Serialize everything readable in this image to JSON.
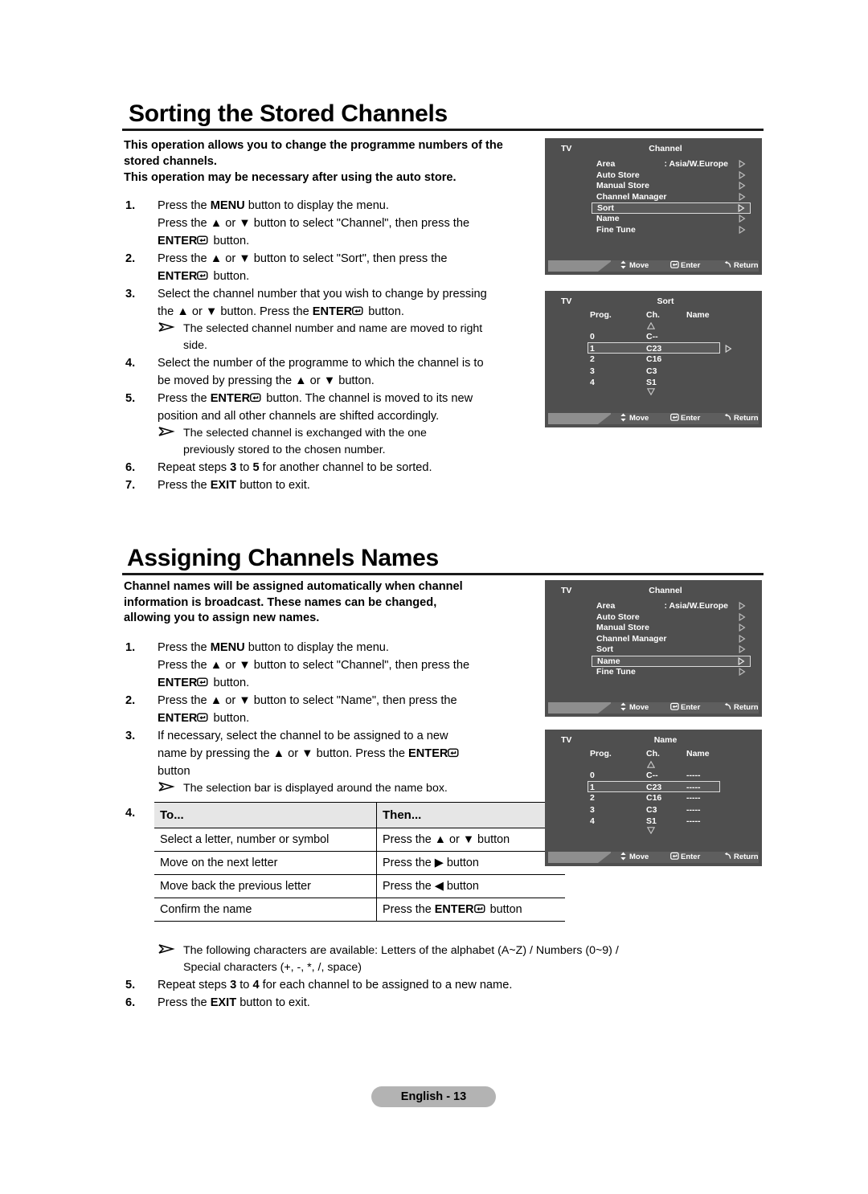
{
  "document": {
    "footer_label": "English - 13"
  },
  "section1": {
    "heading": "Sorting the Stored Channels",
    "intro_line1": "This operation allows you to change the programme numbers of the stored channels.",
    "intro_line2": "This operation may be necessary after using the auto store.",
    "steps": [
      {
        "num": "1.",
        "text_parts": [
          "Press the ",
          "MENU",
          " button to display the menu."
        ]
      },
      {
        "num": "2.",
        "text": "Press the ▲ or ▼ button to select \"Sort\", then press the ENTER button."
      },
      {
        "num": "3.",
        "text": "Select the channel number that you wish to change by pressing the ▲ or ▼ button. Press the ENTER button."
      },
      {
        "num": "4.",
        "text": "Select the number of the programme to which the channel is to be moved by pressing the ▲ or ▼ button."
      },
      {
        "num": "5.",
        "text": "Press the ENTER button. The channel is moved to its new position and all other channels are shifted accordingly."
      },
      {
        "num": "6.",
        "text": "Repeat steps 3 to 5 for another channel to be sorted."
      },
      {
        "num": "7.",
        "text": "Press the EXIT button to exit."
      }
    ],
    "step1_line1_a": "Press the ",
    "step1_line1_menu": "MENU",
    "step1_line1_b": " button to display the menu.",
    "step1_line2_a": "Press the ▲ or ▼ button to select \"Channel\", then press the",
    "step1_line3_enter": "ENTER",
    "step1_line3_b": " button.",
    "step2_a": "Press the ▲ or ▼ button to select \"Sort\", then press the",
    "step2_enter": "ENTER",
    "step2_b": " button.",
    "step3_a": "Select the channel number that you wish to change by pressing",
    "step3_b": "the ▲ or ▼ button. Press the ",
    "step3_enter": "ENTER",
    "step3_c": " button.",
    "note3_line1": "The selected channel number and name are moved to right",
    "note3_line2": "side.",
    "step4_a": "Select the number of the programme to which the channel is to",
    "step4_b": "be moved by pressing the ▲ or ▼ button.",
    "step5_a": "Press the ",
    "step5_enter": "ENTER",
    "step5_b": " button. The channel is moved to its new",
    "step5_c": "position and all other channels are shifted accordingly.",
    "note5_line1": "The selected channel is exchanged with the one",
    "note5_line2": "previously stored to the chosen number.",
    "step6_a": "Repeat steps ",
    "step6_n1": "3",
    "step6_b": " to ",
    "step6_n2": "5",
    "step6_c": " for another channel to be sorted.",
    "step7_a": "Press the ",
    "step7_exit": "EXIT",
    "step7_b": " button to exit."
  },
  "section2": {
    "heading": "Assigning Channels Names",
    "intro_line1": "Channel names will be assigned automatically when channel",
    "intro_line2": "information is broadcast. These names can be changed,",
    "intro_line3": "allowing you to assign new names.",
    "step1_line1_a": "Press the ",
    "step1_line1_menu": "MENU",
    "step1_line1_b": " button to display the menu.",
    "step1_line2": "Press the ▲ or ▼ button to select \"Channel\", then press the",
    "step1_line3_enter": "ENTER",
    "step1_line3_b": " button.",
    "step2_a": "Press the ▲ or ▼ button to select \"Name\", then press the",
    "step2_enter": "ENTER",
    "step2_b": " button.",
    "step3_a": "If necessary, select the channel to be assigned to a new",
    "step3_b": "name by pressing the ▲ or ▼ button. Press the ",
    "step3_enter": "ENTER",
    "step3_c": "button",
    "note3": "The selection bar is displayed around the name box.",
    "step4_num": "4.",
    "table": {
      "headers": [
        "To...",
        "Then..."
      ],
      "rows": [
        {
          "to": "Select a letter, number or symbol",
          "then_a": "Press the ▲ or ▼ button",
          "bold": false
        },
        {
          "to": "Move on the next letter",
          "then_a": "Press the ▶ button",
          "bold": false
        },
        {
          "to": "Move back the previous letter",
          "then_a": "Press the ◀ button",
          "bold": false
        },
        {
          "to": "Confirm the name",
          "then_a": "Press the ",
          "then_enter": "ENTER",
          "then_b": " button",
          "bold": true
        }
      ]
    },
    "note4_line1": "The following characters are available: Letters of the alphabet (A~Z) / Numbers (0~9) /",
    "note4_line2": "Special characters (+, -, *, /, space)",
    "step5_a": "Repeat steps ",
    "step5_n1": "3",
    "step5_b": " to ",
    "step5_n2": "4",
    "step5_c": " for each channel to be assigned to a new name.",
    "step6_a": "Press the ",
    "step6_exit": "EXIT",
    "step6_b": " button to exit."
  },
  "osd_channel_sort": {
    "tv_label": "TV",
    "title": "Channel",
    "items": [
      {
        "label": "Area",
        "value": ": Asia/W.Europe",
        "selected": false
      },
      {
        "label": "Auto Store",
        "value": "",
        "selected": false
      },
      {
        "label": "Manual Store",
        "value": "",
        "selected": false
      },
      {
        "label": "Channel Manager",
        "value": "",
        "selected": false
      },
      {
        "label": "Sort",
        "value": "",
        "selected": true
      },
      {
        "label": "Name",
        "value": "",
        "selected": false
      },
      {
        "label": "Fine Tune",
        "value": "",
        "selected": false
      }
    ],
    "bar": {
      "move": "Move",
      "enter": "Enter",
      "return": "Return"
    }
  },
  "osd_sort": {
    "tv_label": "TV",
    "title": "Sort",
    "headers": {
      "prog": "Prog.",
      "ch": "Ch.",
      "name": "Name"
    },
    "rows": [
      {
        "prog": "0",
        "ch": "C--",
        "name": "",
        "selected": false
      },
      {
        "prog": "1",
        "ch": "C23",
        "name": "",
        "selected": true
      },
      {
        "prog": "2",
        "ch": "C16",
        "name": "",
        "selected": false
      },
      {
        "prog": "3",
        "ch": "C3",
        "name": "",
        "selected": false
      },
      {
        "prog": "4",
        "ch": "S1",
        "name": "",
        "selected": false
      }
    ],
    "bar": {
      "move": "Move",
      "enter": "Enter",
      "return": "Return"
    }
  },
  "osd_channel_name": {
    "tv_label": "TV",
    "title": "Channel",
    "items": [
      {
        "label": "Area",
        "value": ": Asia/W.Europe",
        "selected": false
      },
      {
        "label": "Auto Store",
        "value": "",
        "selected": false
      },
      {
        "label": "Manual Store",
        "value": "",
        "selected": false
      },
      {
        "label": "Channel Manager",
        "value": "",
        "selected": false
      },
      {
        "label": "Sort",
        "value": "",
        "selected": false
      },
      {
        "label": "Name",
        "value": "",
        "selected": true
      },
      {
        "label": "Fine Tune",
        "value": "",
        "selected": false
      }
    ],
    "bar": {
      "move": "Move",
      "enter": "Enter",
      "return": "Return"
    }
  },
  "osd_name": {
    "tv_label": "TV",
    "title": "Name",
    "headers": {
      "prog": "Prog.",
      "ch": "Ch.",
      "name": "Name"
    },
    "rows": [
      {
        "prog": "0",
        "ch": "C--",
        "name": "-----",
        "selected": false
      },
      {
        "prog": "1",
        "ch": "C23",
        "name": "-----",
        "selected": true
      },
      {
        "prog": "2",
        "ch": "C16",
        "name": "-----",
        "selected": false
      },
      {
        "prog": "3",
        "ch": "C3",
        "name": "-----",
        "selected": false
      },
      {
        "prog": "4",
        "ch": "S1",
        "name": "-----",
        "selected": false
      }
    ],
    "bar": {
      "move": "Move",
      "enter": "Enter",
      "return": "Return"
    }
  },
  "icons": {
    "enter_key": "enter-key-icon",
    "note_arrow": "note-arrow-icon",
    "up_arrow": "▲",
    "down_arrow": "▼",
    "right_arrow": "▶",
    "left_arrow": "◀"
  },
  "colors": {
    "osd_bg": "#4f4f4f",
    "osd_bar_dark": "#5e5e5e",
    "osd_bar_light": "#8e8e8e",
    "table_header_bg": "#e6e6e6",
    "footer_pill_bg": "#b3b3b3"
  }
}
